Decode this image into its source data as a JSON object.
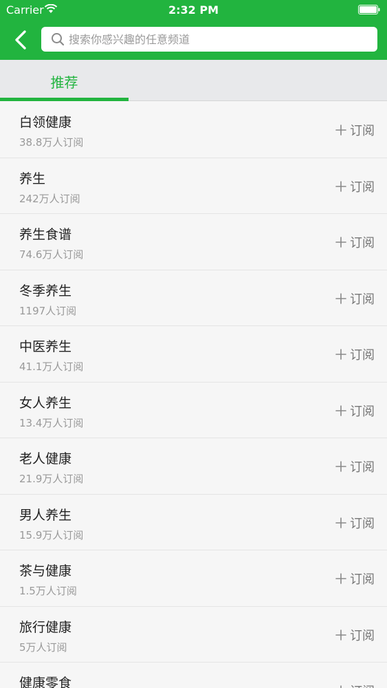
{
  "status_bar": {
    "carrier": "Carrier",
    "time": "2:32 PM"
  },
  "search": {
    "placeholder": "搜索你感兴趣的任意频道"
  },
  "tabs": [
    {
      "label": "推荐"
    }
  ],
  "subscribe_label": "订阅",
  "channels": [
    {
      "name": "白领健康",
      "subscribers": "38.8万人订阅"
    },
    {
      "name": "养生",
      "subscribers": "242万人订阅"
    },
    {
      "name": "养生食谱",
      "subscribers": "74.6万人订阅"
    },
    {
      "name": "冬季养生",
      "subscribers": "1197人订阅"
    },
    {
      "name": "中医养生",
      "subscribers": "41.1万人订阅"
    },
    {
      "name": "女人养生",
      "subscribers": "13.4万人订阅"
    },
    {
      "name": "老人健康",
      "subscribers": "21.9万人订阅"
    },
    {
      "name": "男人养生",
      "subscribers": "15.9万人订阅"
    },
    {
      "name": "茶与健康",
      "subscribers": "1.5万人订阅"
    },
    {
      "name": "旅行健康",
      "subscribers": "5万人订阅"
    },
    {
      "name": "健康零食",
      "subscribers": ""
    }
  ],
  "colors": {
    "brand_green": "#22b43f",
    "tab_bar_bg": "#e8e9eb",
    "list_bg": "#f6f6f6"
  },
  "icons": [
    "wifi-icon",
    "battery-icon",
    "back-arrow-icon",
    "search-icon",
    "plus-icon"
  ]
}
